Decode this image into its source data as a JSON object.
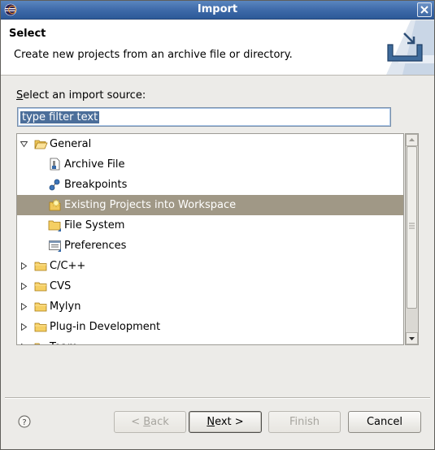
{
  "window": {
    "title": "Import",
    "app_icon": "eclipse-icon",
    "close_icon": "close-icon"
  },
  "header": {
    "title": "Select",
    "description": "Create new projects from an archive file or directory.",
    "banner_icon": "import-tray-icon"
  },
  "source": {
    "label_first": "S",
    "label_rest": "elect an import source:",
    "filter_value": "type filter text"
  },
  "tree": {
    "items": [
      {
        "label": "General",
        "expanded": true,
        "icon": "folder-open-icon",
        "level": 0
      },
      {
        "label": "Archive File",
        "icon": "archive-file-icon",
        "level": 1
      },
      {
        "label": "Breakpoints",
        "icon": "breakpoints-icon",
        "level": 1
      },
      {
        "label": "Existing Projects into Workspace",
        "icon": "existing-projects-icon",
        "level": 1,
        "selected": true
      },
      {
        "label": "File System",
        "icon": "file-system-folder-icon",
        "level": 1
      },
      {
        "label": "Preferences",
        "icon": "preferences-icon",
        "level": 1
      },
      {
        "label": "C/C++",
        "expanded": false,
        "icon": "folder-icon",
        "level": 0
      },
      {
        "label": "CVS",
        "expanded": false,
        "icon": "folder-icon",
        "level": 0
      },
      {
        "label": "Mylyn",
        "expanded": false,
        "icon": "folder-icon",
        "level": 0
      },
      {
        "label": "Plug-in Development",
        "expanded": false,
        "icon": "folder-icon",
        "level": 0
      },
      {
        "label": "Team",
        "expanded": false,
        "icon": "folder-icon",
        "level": 0
      }
    ]
  },
  "buttons": {
    "back_pre": "< ",
    "back_key": "B",
    "back_post": "ack",
    "next_key": "N",
    "next_post": "ext >",
    "finish_label": "Finish",
    "cancel_label": "Cancel",
    "help_icon": "help-icon"
  },
  "colors": {
    "titlebar": "#3d69a8",
    "selection": "#a09886",
    "dialog_bg": "#ecebe8"
  }
}
